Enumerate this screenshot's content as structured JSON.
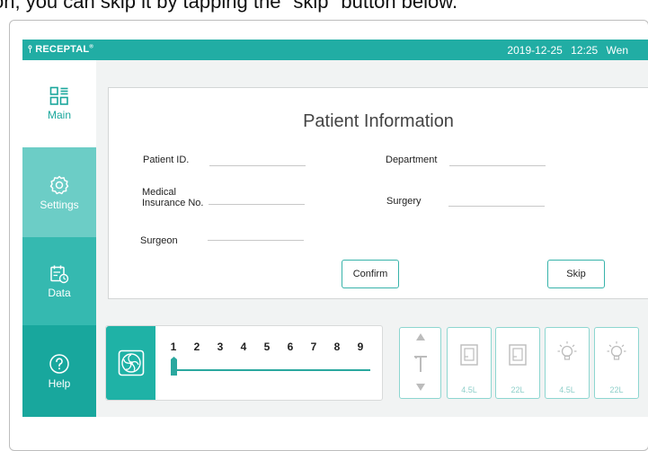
{
  "instruction": "on, you can skip it by tapping the \"skip\" button below.",
  "topbar": {
    "brand": "RECEPTAL",
    "date": "2019-12-25",
    "time": "12:25",
    "weekday": "Wen"
  },
  "sidebar": {
    "items": [
      {
        "label": "Main",
        "icon": "grid-icon"
      },
      {
        "label": "Settings",
        "icon": "gear-icon"
      },
      {
        "label": "Data",
        "icon": "calendar-clock-icon"
      },
      {
        "label": "Help",
        "icon": "question-circle-icon"
      }
    ]
  },
  "form": {
    "title": "Patient Information",
    "patient_id_label": "Patient ID.",
    "medical_label_1": "Medical",
    "medical_label_2": "Insurance No.",
    "surgeon_label": "Surgeon",
    "department_label": "Department",
    "surgery_label": "Surgery",
    "confirm_label": "Confirm",
    "skip_label": "Skip"
  },
  "fan": {
    "icon": "fan-icon",
    "speeds": [
      "1",
      "2",
      "3",
      "4",
      "5",
      "6",
      "7",
      "8",
      "9"
    ],
    "current_speed": 1
  },
  "controls": {
    "suction_tip_icon": "suction-tip-icon",
    "canister_1_caption": "4.5L",
    "canister_2_caption": "22L",
    "light_1_caption": "4.5L",
    "light_2_caption": "22L"
  },
  "colors": {
    "accent": "#21ada4",
    "settings_bg": "#6ccdc6",
    "data_bg": "#35b9b0",
    "help_bg": "#18a79d"
  }
}
